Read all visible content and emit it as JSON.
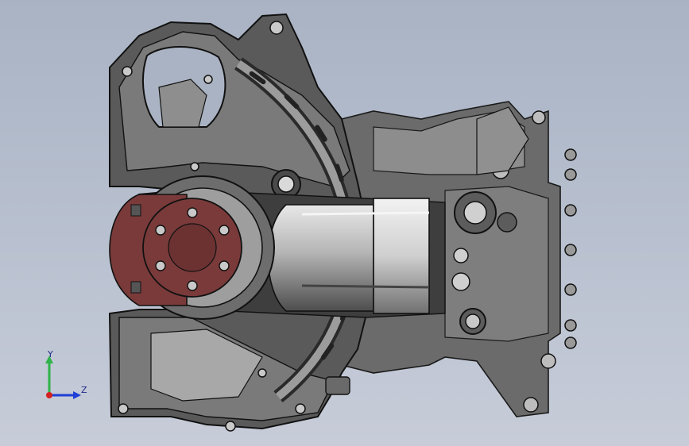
{
  "viewport": {
    "background_top": "#a9b3c4",
    "background_bottom": "#c7ccd8"
  },
  "model": {
    "body_color": "#4a4a4a",
    "face_color": "#bdbdbd",
    "highlight_color": "#e6e6e6",
    "section_color": "#7a3a3a"
  },
  "triad": {
    "y_label": "Y",
    "z_label": "Z",
    "y_color": "#2fb34a",
    "z_color": "#1f3fd6",
    "x_color": "#d62020"
  }
}
